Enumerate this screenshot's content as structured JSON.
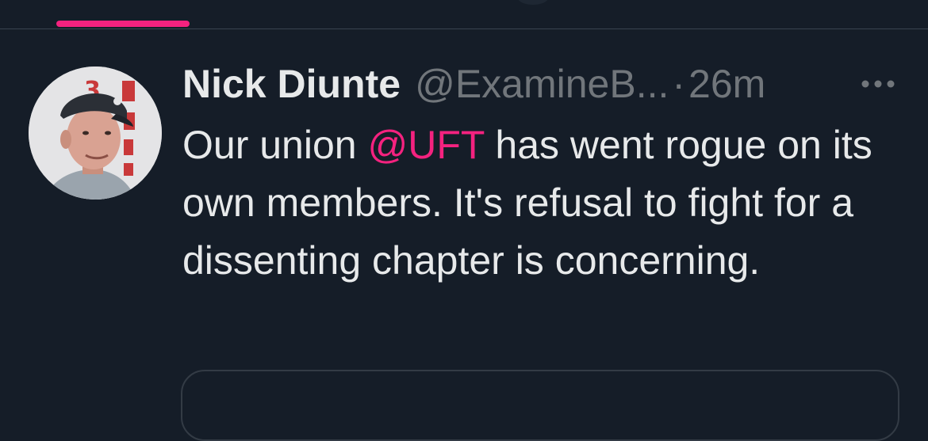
{
  "tweet": {
    "author": {
      "display_name": "Nick Diunte",
      "handle": "@ExamineB...",
      "avatar_icon": "profile-photo"
    },
    "separator": "·",
    "timestamp": "26m",
    "more_icon": "more-horizontal-icon",
    "text": {
      "before_mention": "Our union ",
      "mention": "@UFT",
      "after_mention": " has went rogue on its own members. It's refusal to fight for a dissenting chapter is concerning."
    }
  },
  "colors": {
    "background": "#151d28",
    "accent": "#f4227f",
    "text_primary": "#e7e9ea",
    "text_secondary": "#71767b"
  }
}
